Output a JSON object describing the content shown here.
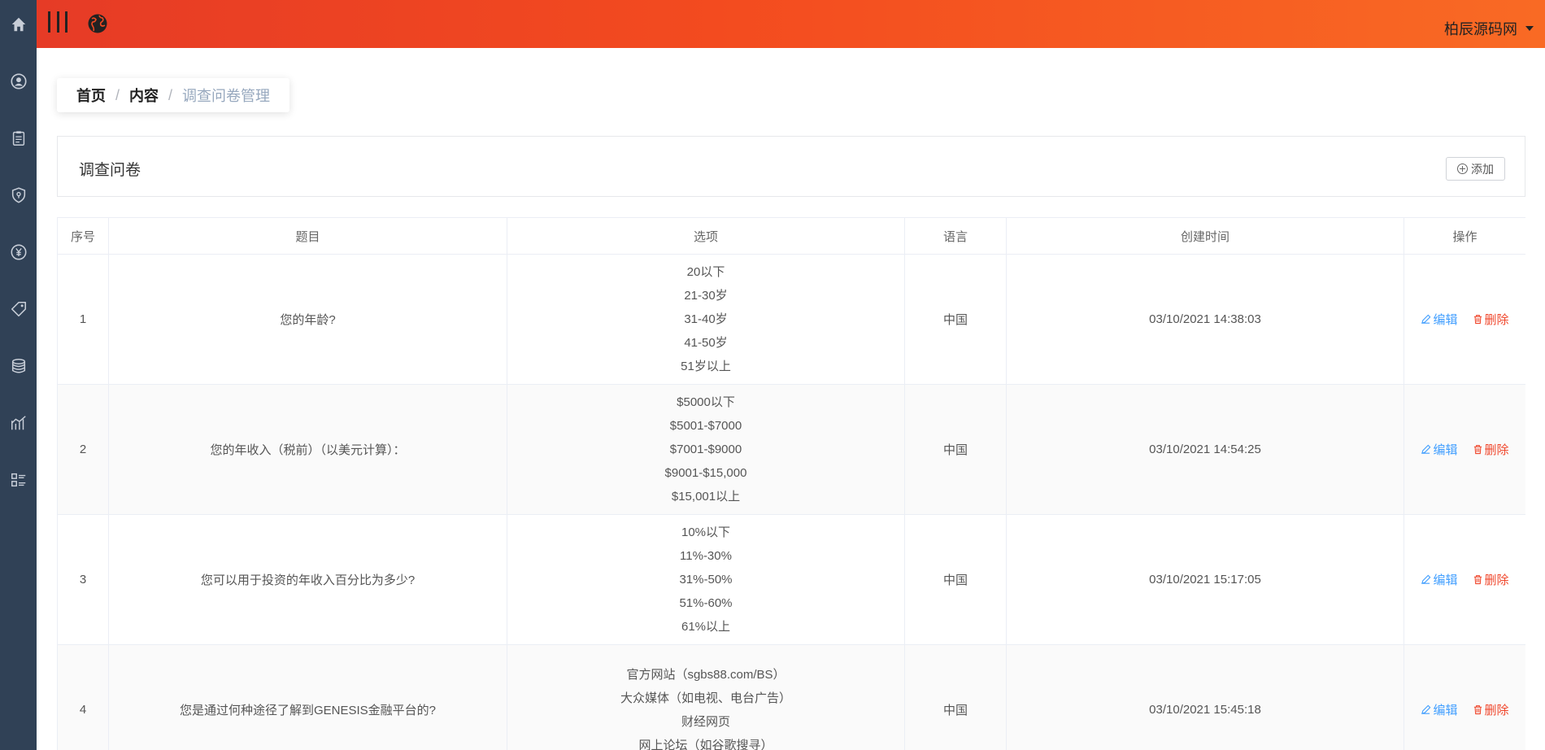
{
  "header": {
    "site_name": "柏辰源码网"
  },
  "sidebar": {
    "icons": [
      "home-icon",
      "user-circle-icon",
      "clipboard-icon",
      "shield-icon",
      "yen-icon",
      "tag-icon",
      "coins-icon",
      "chart-icon",
      "list-icon"
    ]
  },
  "breadcrumb": {
    "home": "首页",
    "content": "内容",
    "current": "调查问卷管理",
    "separator": "/"
  },
  "card": {
    "title": "调查问卷",
    "add_label": "添加"
  },
  "table": {
    "columns": [
      "序号",
      "题目",
      "选项",
      "语言",
      "创建时间",
      "操作"
    ],
    "edit_label": "编辑",
    "delete_label": "删除",
    "rows": [
      {
        "index": "1",
        "question": "您的年龄?",
        "options": [
          "20以下",
          "21-30岁",
          "31-40岁",
          "41-50岁",
          "51岁以上"
        ],
        "language": "中国",
        "created": "03/10/2021 14:38:03"
      },
      {
        "index": "2",
        "question": "您的年收入（税前）（以美元计算）：",
        "options": [
          "$5000以下",
          "$5001-$7000",
          "$7001-$9000",
          "$9001-$15,000",
          "$15,001以上"
        ],
        "language": "中国",
        "created": "03/10/2021 14:54:25"
      },
      {
        "index": "3",
        "question": "您可以用于投资的年收入百分比为多少?",
        "options": [
          "10%以下",
          "11%-30%",
          "31%-50%",
          "51%-60%",
          "61%以上"
        ],
        "language": "中国",
        "created": "03/10/2021 15:17:05"
      },
      {
        "index": "4",
        "question": "您是通过何种途径了解到GENESIS金融平台的?",
        "options": [
          "官方网站（sgbs88.com/BS）",
          "大众媒体（如电视、电台广告）",
          "财经网页",
          "网上论坛（如谷歌搜寻）"
        ],
        "language": "中国",
        "created": "03/10/2021 15:45:18"
      }
    ]
  }
}
